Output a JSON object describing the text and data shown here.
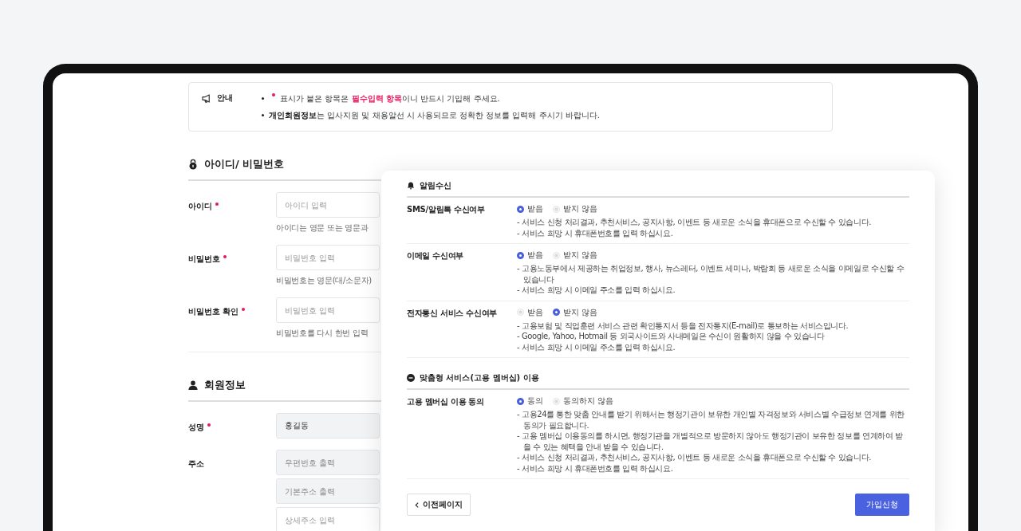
{
  "notice": {
    "label": "안내",
    "lines": [
      {
        "segments": [
          {
            "kind": "required_mark"
          },
          {
            "kind": "plain",
            "text": "표시가 붙은 항목은 "
          },
          {
            "kind": "highlight",
            "text": "필수입력 항목"
          },
          {
            "kind": "plain",
            "text": "이니 반드시 기입해 주세요."
          }
        ]
      },
      {
        "segments": [
          {
            "kind": "strong",
            "text": "개인회원정보"
          },
          {
            "kind": "plain",
            "text": "는 입사지원 및 채용알선 시 사용되므로 정확한 정보를 입력해 주시기 바랍니다."
          }
        ]
      }
    ]
  },
  "form_sections": [
    {
      "title": "아이디/ 비밀번호",
      "fields": [
        {
          "label": "아이디",
          "required": true,
          "inputs": [
            {
              "placeholder": "아이디 입력",
              "disabled": false
            }
          ],
          "hint": "아이디는 영문 또는 영문과"
        },
        {
          "label": "비밀번호",
          "required": true,
          "inputs": [
            {
              "placeholder": "비밀번호 입력",
              "disabled": false
            }
          ],
          "hint": "비밀번호는 영문(대/소문자)"
        },
        {
          "label": "비밀번호 확인",
          "required": true,
          "inputs": [
            {
              "placeholder": "비밀번호 입력",
              "disabled": false
            }
          ],
          "hint": "비밀번호를 다시 한번 입력"
        }
      ]
    },
    {
      "title": "회원정보",
      "fields": [
        {
          "label": "성명",
          "required": true,
          "inputs": [
            {
              "value": "홍길동",
              "disabled": true
            }
          ]
        },
        {
          "label": "주소",
          "required": false,
          "inputs": [
            {
              "placeholder": "우편번호 출력",
              "disabled": true
            },
            {
              "placeholder": "기본주소 출력",
              "disabled": true
            },
            {
              "placeholder": "상세주소 입력",
              "disabled": false
            }
          ]
        }
      ]
    }
  ],
  "consent_sections": [
    {
      "title": "알림수신",
      "rows": [
        {
          "label": "SMS/알림톡 수신여부",
          "options": [
            {
              "label": "받음",
              "selected": true
            },
            {
              "label": "받지 않음",
              "selected": false
            }
          ],
          "notes": [
            "- 서비스 신청 처리결과, 추천서비스, 공지사항, 이벤트 등 새로운 소식을 휴대폰으로 수신할 수 있습니다.",
            "- 서비스 희망 시 휴대폰번호를 입력 하십시요."
          ]
        },
        {
          "label": "이메일 수신여부",
          "options": [
            {
              "label": "받음",
              "selected": true
            },
            {
              "label": "받지 않음",
              "selected": false
            }
          ],
          "notes": [
            "- 고용노동부에서 제공하는 취업정보, 행사, 뉴스레터, 이벤트 세미나, 박람회 등 새로운 소식을 이메일로 수신할 수 있습니다",
            "- 서비스 희망 시 이메일 주소를 입력 하십시요."
          ]
        },
        {
          "label": "전자통신 서비스 수신여부",
          "options": [
            {
              "label": "받음",
              "selected": false
            },
            {
              "label": "받지 않음",
              "selected": true
            }
          ],
          "notes": [
            "- 고용보험 및 직업훈련 서비스 관련 확인통지서 등을 전자통지(E-mail)로 통보하는 서비스입니다.",
            "- Google, Yahoo, Hotmail 등 외국사이트와 사내메일은 수신이 원활하지 않을 수 있습니다",
            "- 서비스 희망 시 이메일 주소를 입력 하십시요."
          ]
        }
      ]
    },
    {
      "title": "맞춤형 서비스(고용 멤버십) 이용",
      "rows": [
        {
          "label": "고용 멤버십 이용 동의",
          "options": [
            {
              "label": "동의",
              "selected": true
            },
            {
              "label": "동의하지 않음",
              "selected": false
            }
          ],
          "notes": [
            "- 고용24를 통한 맞춤 안내를 받기 위해서는 행정기관이 보유한 개인별 자격정보와 서비스별 수급정보 연계를 위한 동의가 필요합니다.",
            "- 고용 멤버십 이용동의를 하시면, 행정기관을 개별적으로 방문하지 않아도 행정기관이 보유한 정보를 연계하여 받을 수 있는 혜택을 안내 받을 수 있습니다.",
            "- 서비스 신청 처리결과, 추천서비스, 공지사항, 이벤트 등 새로운 소식을 휴대폰으로 수신할 수 있습니다.",
            "- 서비스 희망 시 휴대폰번호를 입력 하십시요."
          ]
        }
      ]
    }
  ],
  "buttons": {
    "back": "이전페이지",
    "submit": "가입신청"
  }
}
